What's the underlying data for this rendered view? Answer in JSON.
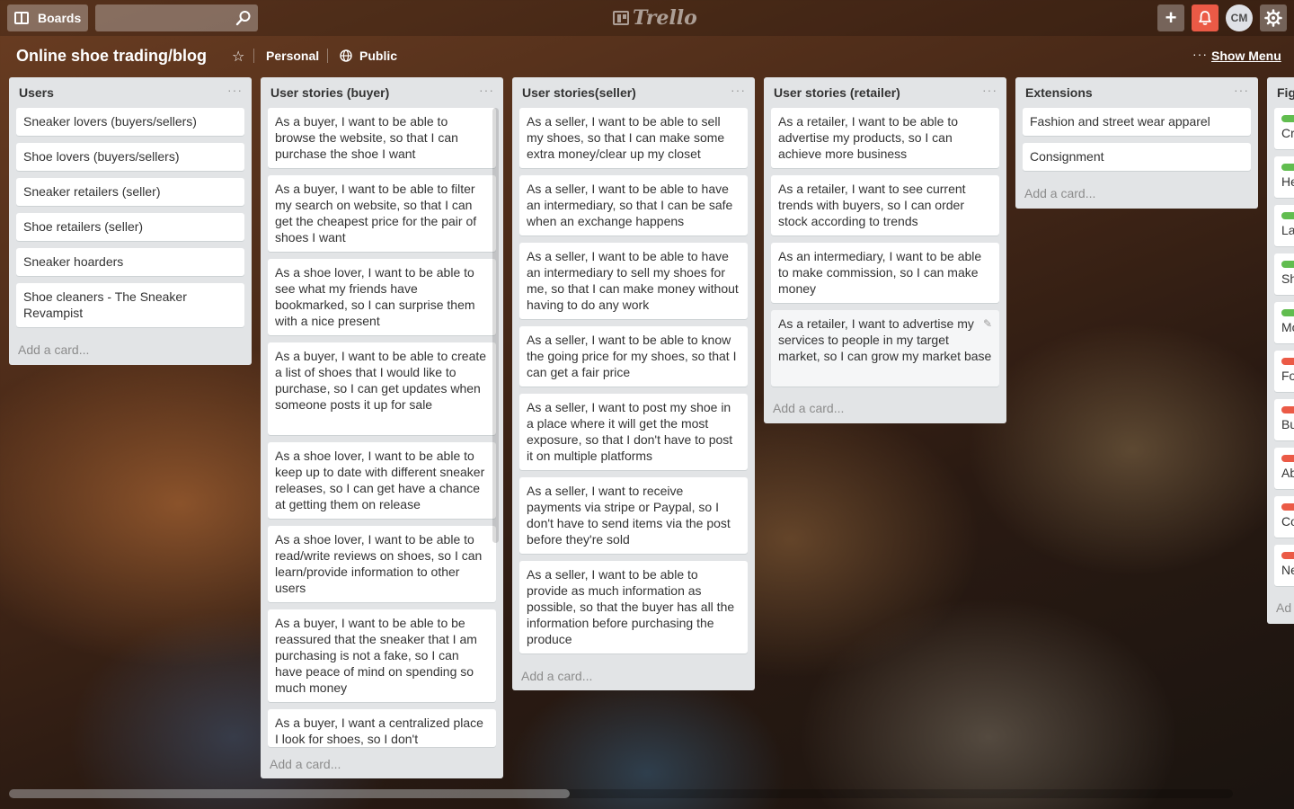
{
  "header": {
    "boards_label": "Boards",
    "search_value": "",
    "logo_text": "Trello",
    "add_label": "+",
    "avatar_initials": "CM"
  },
  "board": {
    "title": "Online shoe trading/blog",
    "team": "Personal",
    "visibility": "Public",
    "show_menu": "Show Menu",
    "menu_dots": "···"
  },
  "list_menu": "···",
  "lists": [
    {
      "title": "Users",
      "cards": [
        "Sneaker lovers (buyers/sellers)",
        "Shoe lovers (buyers/sellers)",
        "Sneaker retailers (seller)",
        "Shoe retailers (seller)",
        "Sneaker hoarders",
        "Shoe cleaners - The Sneaker Revampist"
      ],
      "add_card": "Add a card..."
    },
    {
      "title": "User stories (buyer)",
      "cards": [
        "As a buyer, I want to be able to browse the website, so that I can purchase the shoe I want",
        "As a buyer, I want to be able to filter my search on website, so that I can get the cheapest price for the pair of shoes I want",
        "As a shoe lover, I want to be able to see what my friends have bookmarked, so I can surprise them with a nice present",
        "As a buyer, I want to be able to create a list of shoes that I would like to purchase, so I can get updates when someone posts it up for sale",
        "As a shoe lover, I want to be able to keep up to date with different sneaker releases, so I can get have a chance at getting them on release",
        "As a shoe lover, I want to be able to read/write reviews on shoes, so I can learn/provide information to other users",
        "As a buyer, I want to be able to be reassured that the sneaker that I am purchasing is not a fake, so I can have peace of mind on spending so much money",
        "As a buyer, I want a centralized place I look for shoes, so I don't"
      ],
      "add_card": "Add a card..."
    },
    {
      "title": "User stories(seller)",
      "cards": [
        "As a seller, I want to be able to sell my shoes, so that I can make some extra money/clear up my closet",
        "As a seller, I want to be able to have an intermediary, so that I can be safe when an exchange happens",
        "As a seller, I want to be able to have an intermediary to sell my shoes for me, so that I can make money without having to do any work",
        "As a seller, I want to be able to know the going price for my shoes, so that I can get a fair price",
        "As a seller, I want to post my shoe in a place where it will get the most exposure, so that I don't have to post it on multiple platforms",
        "As a seller, I want to receive payments via stripe or Paypal, so I don't have to send items via the post before they're sold",
        "As a seller, I want to be able to provide as much information as possible, so that the buyer has all the information before purchasing the produce"
      ],
      "add_card": "Add a card..."
    },
    {
      "title": "User stories (retailer)",
      "cards": [
        "As a retailer, I want to be able to advertise my products, so I can achieve more business",
        "As a retailer, I want to see current trends with buyers, so I can order stock according to trends",
        "As an intermediary, I want to be able to make commission, so I can make money",
        "As a retailer, I want to advertise my services to people in my target market, so I can grow my market base"
      ],
      "add_card": "Add a card..."
    },
    {
      "title": "Extensions",
      "cards": [
        "Fashion and street wear apparel",
        "Consignment"
      ],
      "add_card": "Add a card..."
    }
  ],
  "partial_list": {
    "title": "Fig",
    "cards": [
      {
        "text": "Cr",
        "label_color": "#61bd4f"
      },
      {
        "text": "He",
        "label_color": "#61bd4f"
      },
      {
        "text": "La",
        "label_color": "#61bd4f"
      },
      {
        "text": "Sh",
        "label_color": "#61bd4f"
      },
      {
        "text": "Mo",
        "label_color": "#61bd4f"
      },
      {
        "text": "Fo",
        "label_color": "#eb5a46"
      },
      {
        "text": "Bu",
        "label_color": "#eb5a46"
      },
      {
        "text": "Ab",
        "label_color": "#eb5a46"
      },
      {
        "text": "Co",
        "label_color": "#eb5a46"
      },
      {
        "text": "Ne",
        "label_color": "#eb5a46"
      }
    ],
    "add_card": "Ad"
  },
  "colors": {
    "notification": "#eb5a46",
    "list_bg": "#e2e4e6",
    "label_green": "#61bd4f",
    "label_red": "#eb5a46"
  }
}
